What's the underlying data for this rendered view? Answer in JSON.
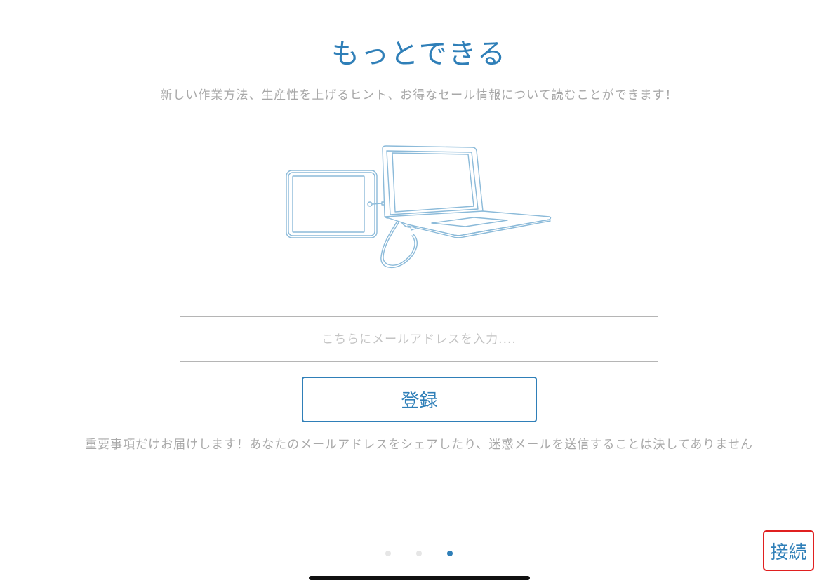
{
  "header": {
    "title": "もっとできる",
    "subtitle": "新しい作業方法、生産性を上げるヒント、お得なセール情報について読むことができます！"
  },
  "illustration": {
    "icon": "ipad-connected-to-macbook-illustration",
    "stroke_color": "#8bbad9"
  },
  "form": {
    "email_placeholder": "こちらにメールアドレスを入力....",
    "email_value": "",
    "submit_label": "登録"
  },
  "privacy_note": "重要事項だけお届けします！あなたのメールアドレスをシェアしたり、迷惑メールを送信することは決してありません",
  "pager": {
    "total": 3,
    "current": 3
  },
  "connect_label": "接続",
  "colors": {
    "accent": "#2f7fb8",
    "muted_text": "#a8a8a8",
    "highlight_border": "#e02020"
  }
}
